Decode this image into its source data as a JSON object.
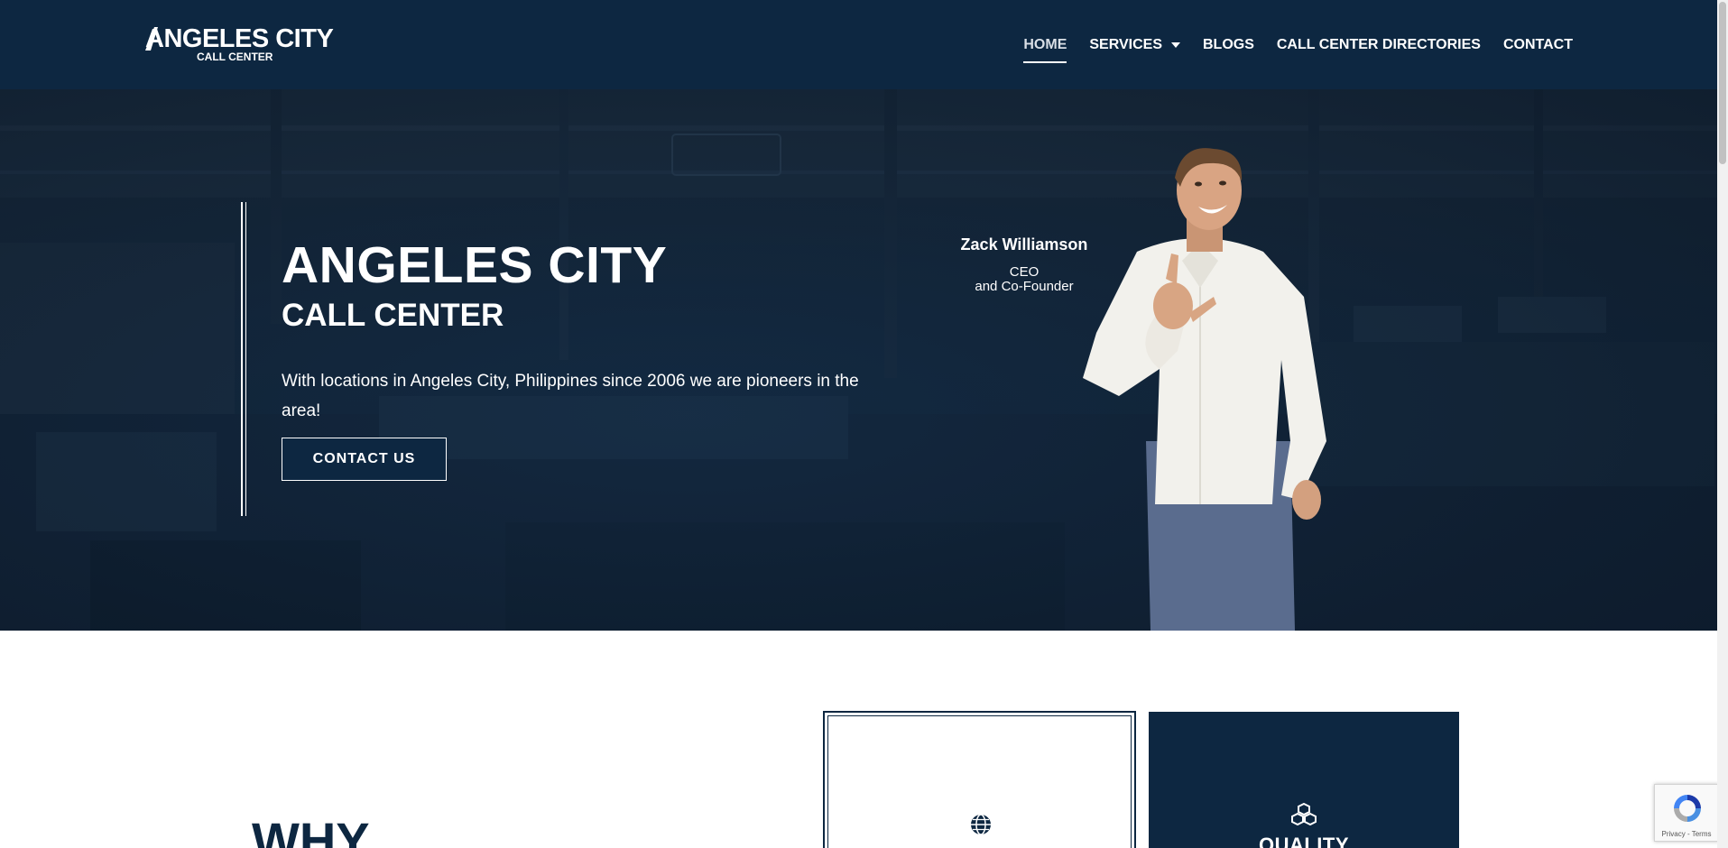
{
  "header": {
    "logo_main": "ANGELES CITY",
    "logo_sub": "CALL CENTER",
    "nav": [
      {
        "label": "HOME",
        "active": true
      },
      {
        "label": "SERVICES",
        "has_dropdown": true
      },
      {
        "label": "BLOGS"
      },
      {
        "label": "CALL CENTER DIRECTORIES"
      },
      {
        "label": "CONTACT"
      }
    ]
  },
  "hero": {
    "title": "ANGELES CITY",
    "subtitle": "CALL CENTER",
    "text": "With locations in Angeles City, Philippines since 2006 we are pioneers in the area!",
    "button_label": "CONTACT US",
    "ceo_name": "Zack Williamson",
    "ceo_role_line1": "CEO",
    "ceo_role_line2": "and Co-Founder"
  },
  "why": {
    "title": "WHY"
  },
  "cards": {
    "card1_icon": "globe-icon",
    "card2_icon": "cubes-icon",
    "card2_label": "QUALITY"
  },
  "recaptcha": {
    "privacy": "Privacy",
    "sep": " - ",
    "terms": "Terms"
  },
  "colors": {
    "navy": "#0d2741",
    "white": "#ffffff"
  }
}
